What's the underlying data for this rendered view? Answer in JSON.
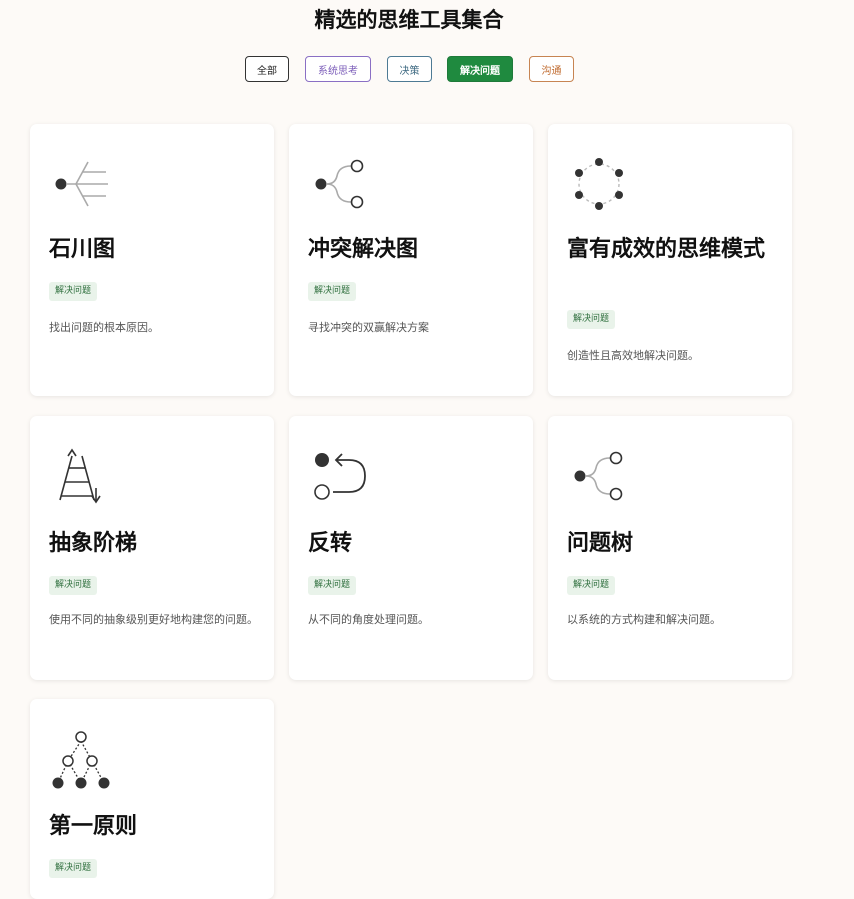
{
  "page": {
    "title": "精选的思维工具集合"
  },
  "filters": [
    {
      "label": "全部",
      "color": "#333333"
    },
    {
      "label": "系统思考",
      "color": "#7a5bb8"
    },
    {
      "label": "决策",
      "color": "#3f6a82"
    },
    {
      "label": "解决问题",
      "color": "#1f8a3f",
      "active": true
    },
    {
      "label": "沟通",
      "color": "#c06a2e"
    }
  ],
  "cards": [
    {
      "title": "石川图",
      "tag": "解决问题",
      "description": "找出问题的根本原因。",
      "icon": "fishbone-icon"
    },
    {
      "title": "冲突解决图",
      "tag": "解决问题",
      "description": "寻找冲突的双赢解决方案",
      "icon": "branch-fork-icon"
    },
    {
      "title": "富有成效的思维模式",
      "tag": "解决问题",
      "description": "创造性且高效地解决问题。",
      "icon": "dotted-circle-icon"
    },
    {
      "title": "抽象阶梯",
      "tag": "解决问题",
      "description": "使用不同的抽象级别更好地构建您的问题。",
      "icon": "ladder-icon"
    },
    {
      "title": "反转",
      "tag": "解决问题",
      "description": "从不同的角度处理问题。",
      "icon": "inversion-loop-icon"
    },
    {
      "title": "问题树",
      "tag": "解决问题",
      "description": "以系统的方式构建和解决问题。",
      "icon": "issue-tree-icon"
    },
    {
      "title": "第一原则",
      "tag": "解决问题",
      "description": "",
      "icon": "node-tree-icon"
    }
  ]
}
